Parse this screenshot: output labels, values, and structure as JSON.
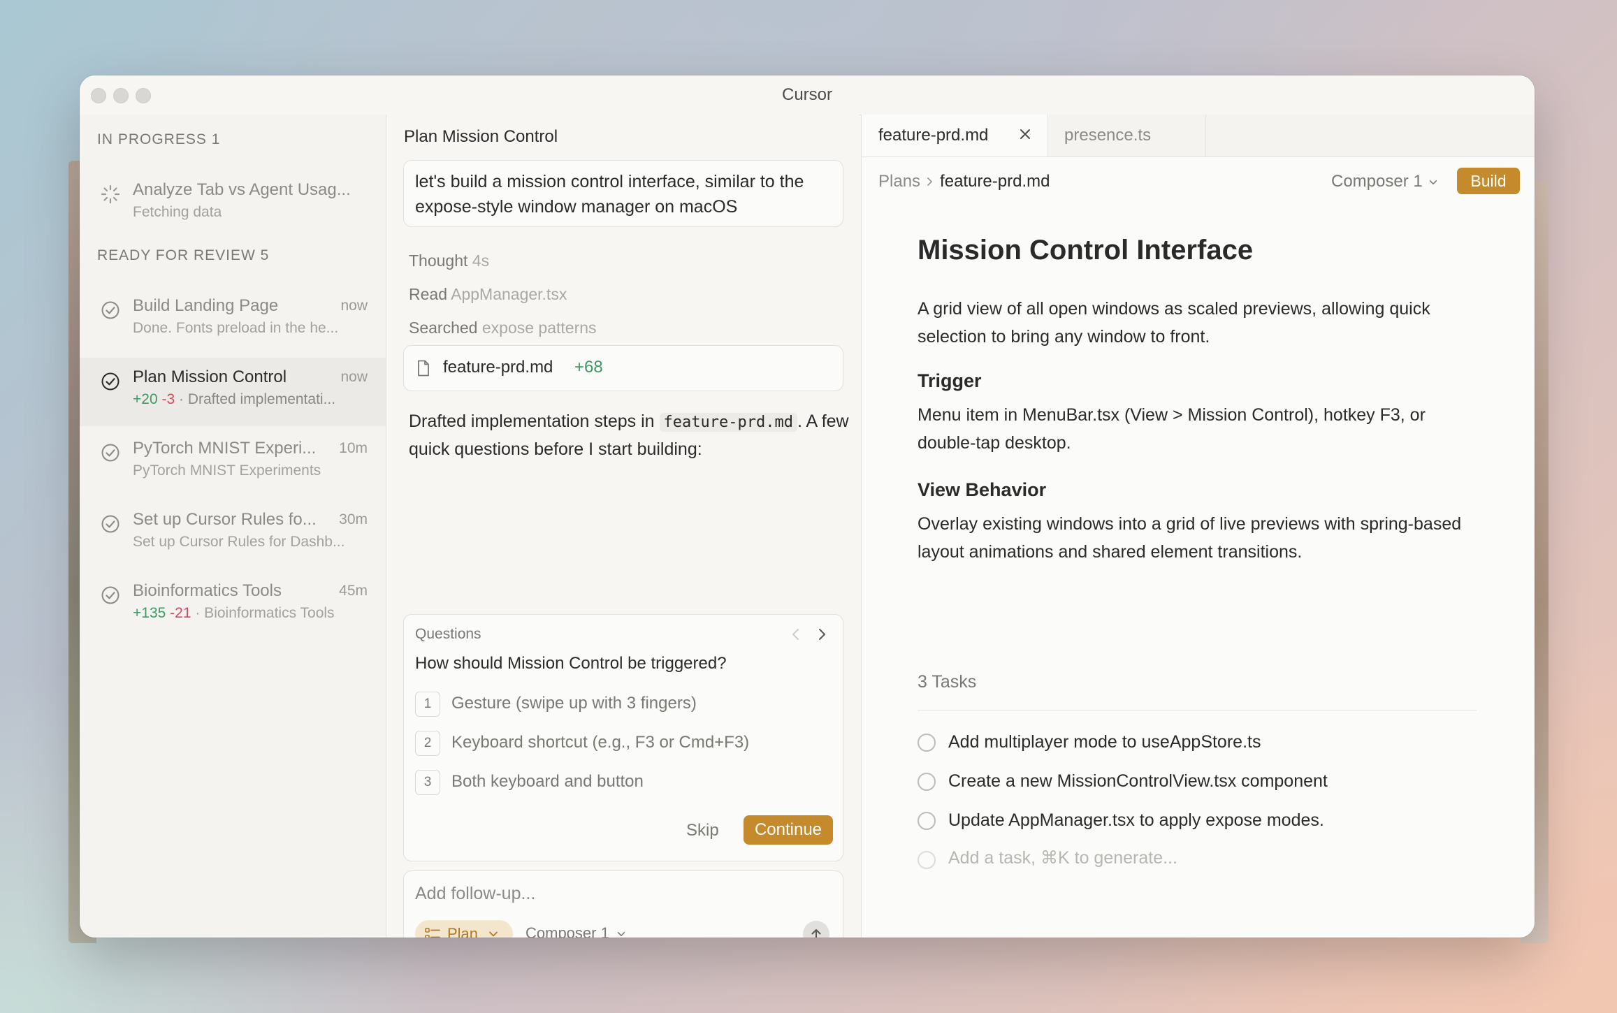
{
  "window": {
    "title": "Cursor"
  },
  "sidebar": {
    "in_progress": {
      "title": "IN PROGRESS 1",
      "items": [
        {
          "name": "Analyze Tab vs Agent Usag...",
          "subtitle": "Fetching data"
        }
      ]
    },
    "ready_for_review": {
      "title": "READY FOR REVIEW 5",
      "items": [
        {
          "name": "Build Landing Page",
          "time": "now",
          "subtitle": "Done. Fonts preload in the he..."
        },
        {
          "name": "Plan Mission Control",
          "time": "now",
          "additions": "+20",
          "deletions": "-3",
          "subtitle": "· Drafted implementati..."
        },
        {
          "name": "PyTorch MNIST Experi...",
          "time": "10m",
          "subtitle": "PyTorch MNIST Experiments"
        },
        {
          "name": "Set up Cursor Rules fo...",
          "time": "30m",
          "subtitle": "Set up Cursor Rules for Dashb..."
        },
        {
          "name": "Bioinformatics Tools",
          "time": "45m",
          "additions": "+135",
          "deletions": "-21",
          "subtitle": "· Bioinformatics Tools"
        }
      ]
    }
  },
  "chat": {
    "title": "Plan Mission Control",
    "prompt": "let's build a mission control interface, similar to the expose-style window manager on macOS",
    "steps": [
      {
        "label": "Thought",
        "detail": "4s"
      },
      {
        "label": "Read",
        "detail": "AppManager.tsx"
      },
      {
        "label": "Searched",
        "detail": "expose patterns"
      }
    ],
    "file_card": {
      "name": "feature-prd.md",
      "additions": "+68"
    },
    "reply": {
      "before": "Drafted implementation steps in ",
      "code": "feature-prd.md",
      "after": ". A few quick questions before I start building:"
    },
    "questions": {
      "label": "Questions",
      "question": "How should Mission Control be triggered?",
      "options": [
        {
          "num": "1",
          "label": "Gesture (swipe up with 3 fingers)"
        },
        {
          "num": "2",
          "label": "Keyboard shortcut (e.g., F3 or Cmd+F3)"
        },
        {
          "num": "3",
          "label": "Both keyboard and button"
        }
      ],
      "skip": "Skip",
      "continue": "Continue"
    },
    "followup": {
      "placeholder": "Add follow-up...",
      "mode": "Plan",
      "model": "Composer 1"
    }
  },
  "editor": {
    "tabs": [
      {
        "label": "feature-prd.md"
      },
      {
        "label": "presence.ts"
      }
    ],
    "breadcrumb": {
      "root": "Plans",
      "current": "feature-prd.md"
    },
    "model": "Composer 1",
    "build": "Build",
    "doc": {
      "title": "Mission Control Interface",
      "intro": "A grid view of all open windows as scaled previews, allowing quick selection to bring any window to front.",
      "sections": [
        {
          "heading": "Trigger",
          "body": "Menu item in MenuBar.tsx (View > Mission Control), hotkey F3, or double-tap desktop."
        },
        {
          "heading": "View Behavior",
          "body": "Overlay existing windows into a grid of live previews with spring-based layout animations and shared element transitions."
        }
      ]
    },
    "tasks": {
      "header": "3 Tasks",
      "items": [
        {
          "label": "Add multiplayer mode to useAppStore.ts"
        },
        {
          "label": "Create a new MissionControlView.tsx component"
        },
        {
          "label": "Update AppManager.tsx to apply expose modes."
        }
      ],
      "placeholder": "Add a task, ⌘K to generate..."
    }
  },
  "colors": {
    "accent": "#c48a2b",
    "additions": "#3c9a64",
    "deletions": "#cf4a5f"
  }
}
